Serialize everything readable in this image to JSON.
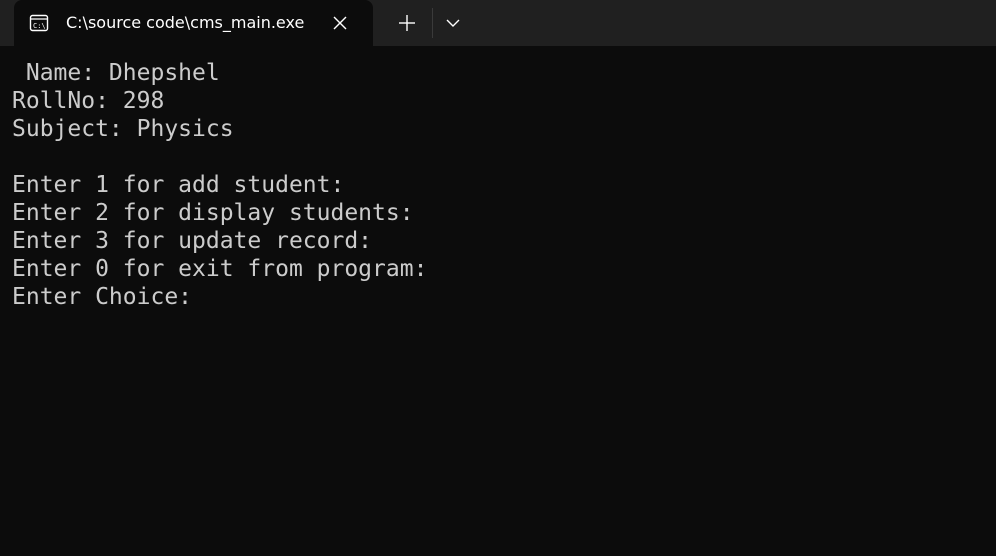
{
  "tab": {
    "title": "C:\\source code\\cms_main.exe",
    "icon": "console-icon"
  },
  "titlebar": {
    "close_icon": "close-icon",
    "new_tab_icon": "plus-icon",
    "dropdown_icon": "chevron-down-icon"
  },
  "console": {
    "lines": [
      " Name: Dhepshel",
      "RollNo: 298",
      "Subject: Physics",
      "",
      "Enter 1 for add student:",
      "Enter 2 for display students:",
      "Enter 3 for update record:",
      "Enter 0 for exit from program:",
      "Enter Choice:"
    ]
  },
  "colors": {
    "background": "#0c0c0c",
    "titlebar": "#202020",
    "text": "#cccccc",
    "tab_text": "#ffffff"
  }
}
